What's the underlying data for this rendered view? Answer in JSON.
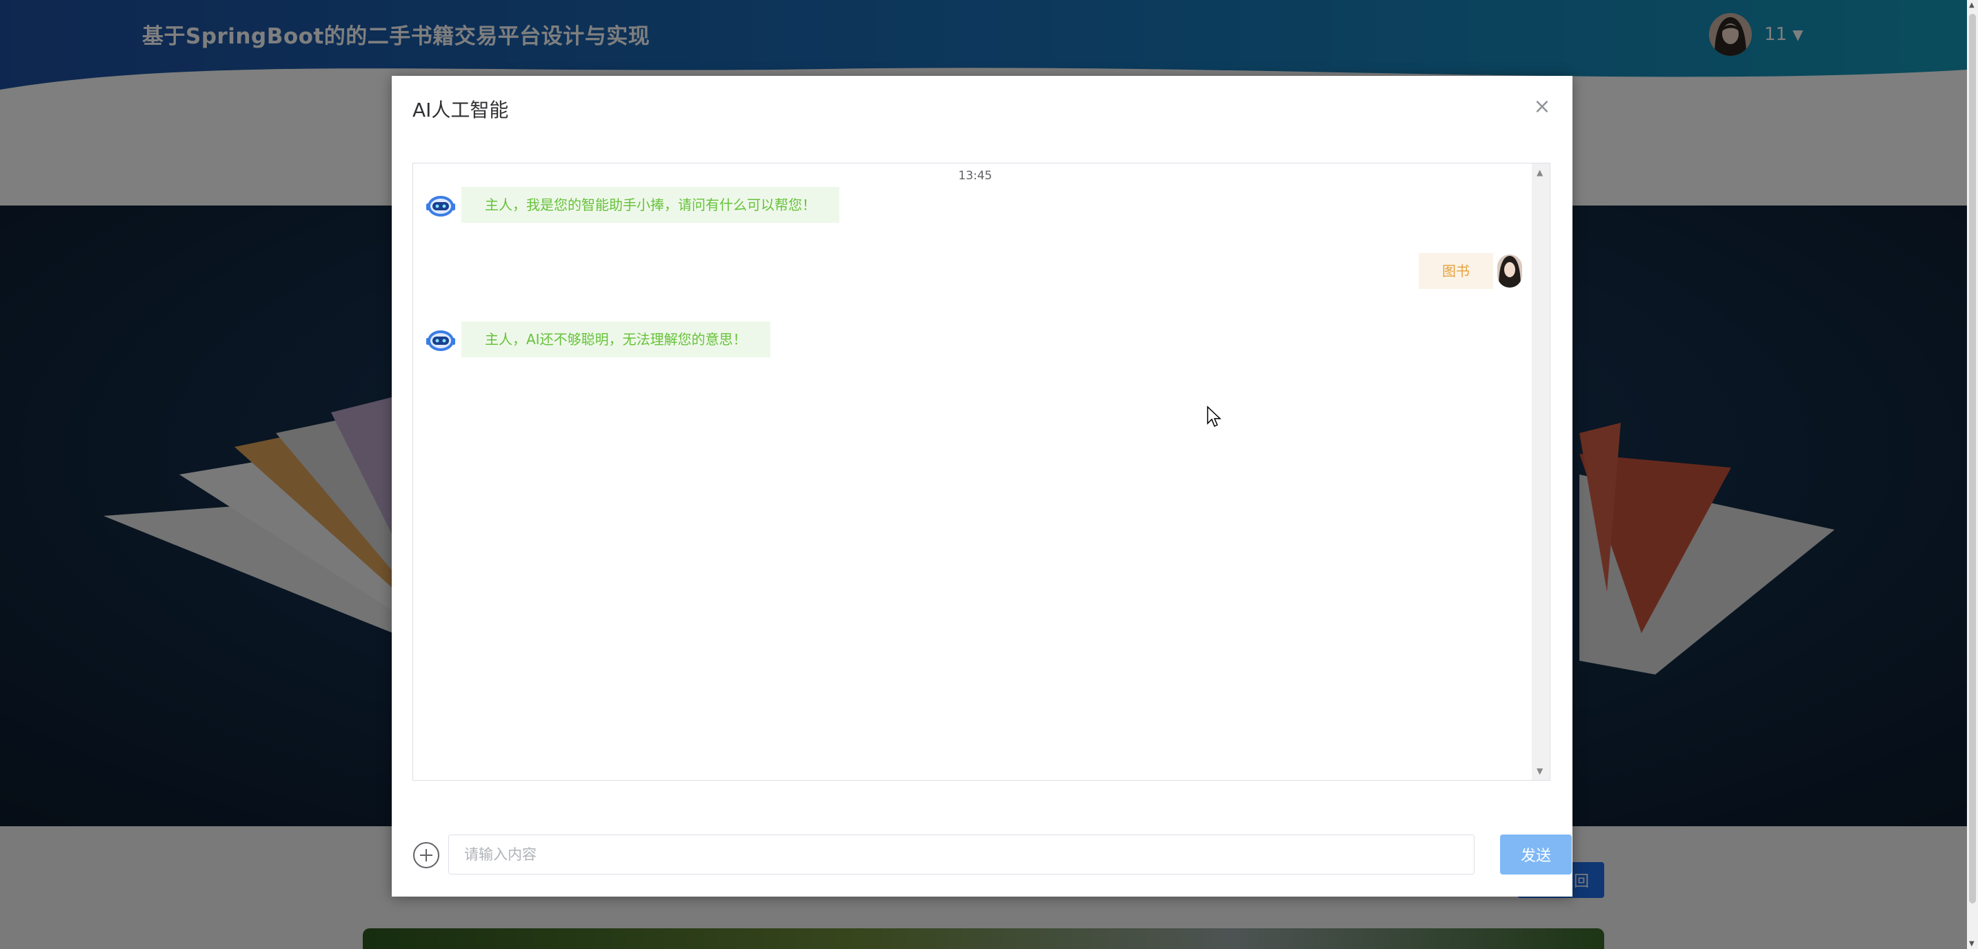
{
  "site": {
    "title": "基于SpringBoot的的二手书籍交易平台设计与实现",
    "user_name": "11",
    "bg_button_label": "回"
  },
  "dialog": {
    "title": "AI人工智能",
    "close_icon": "close-icon",
    "messages": [
      {
        "time": "13:45"
      },
      {
        "from": "ai",
        "avatar": "robot-icon",
        "text": "主人，我是您的智能助手小捧，请问有什么可以帮您！"
      },
      {
        "from": "user",
        "avatar": "user-avatar",
        "text": "图书"
      },
      {
        "from": "ai",
        "avatar": "robot-icon",
        "text": "主人，AI还不够聪明，无法理解您的意思！"
      }
    ],
    "input": {
      "placeholder": "请输入内容",
      "value": ""
    },
    "send_label": "发送"
  },
  "colors": {
    "ai_bubble_bg": "#eef8ea",
    "ai_text": "#67c23a",
    "user_bubble_bg": "#fbf3e8",
    "user_text": "#e6a23c",
    "send_button": "#7fb8f5",
    "header_wave": "#1f5aa8"
  }
}
